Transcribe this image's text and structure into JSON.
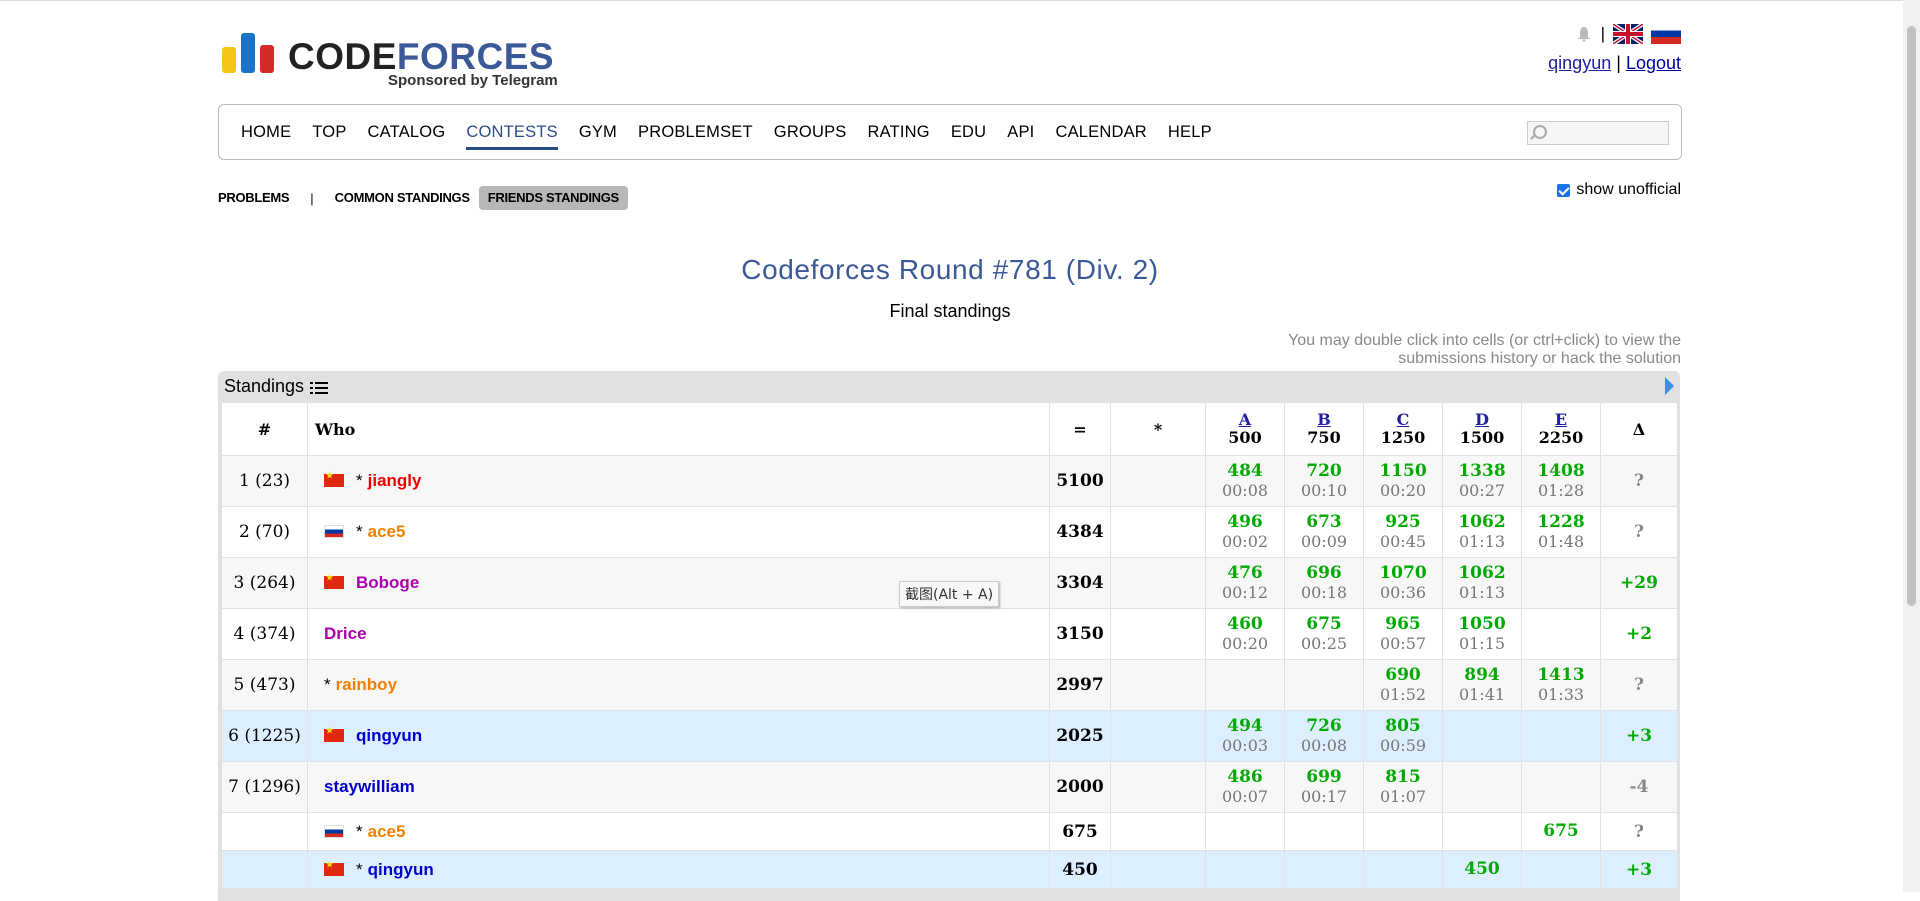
{
  "header": {
    "logo_word_main": "CODE",
    "logo_word_accent": "FORCES",
    "logo_sponsor": "Sponsored by Telegram",
    "user": "qingyun",
    "separator": "|",
    "logout": "Logout"
  },
  "menu": {
    "items": [
      "HOME",
      "TOP",
      "CATALOG",
      "CONTESTS",
      "GYM",
      "PROBLEMSET",
      "GROUPS",
      "RATING",
      "EDU",
      "API",
      "CALENDAR",
      "HELP"
    ],
    "active": "CONTESTS",
    "search_placeholder": ""
  },
  "subnav": {
    "problems": "PROBLEMS",
    "sep": "|",
    "common": "COMMON STANDINGS",
    "friends": "FRIENDS STANDINGS",
    "show_unofficial": "show unofficial"
  },
  "contest": {
    "title": "Codeforces Round #781 (Div. 2)",
    "status": "Final standings",
    "hint": "You may double click into cells (or ctrl+click) to view the submissions history or hack the solution"
  },
  "standings": {
    "panel_title": "Standings",
    "columns": {
      "rank": "#",
      "who": "Who",
      "points": "=",
      "penalty": "*",
      "delta": "Δ"
    },
    "problems": [
      {
        "letter": "A",
        "score": "500"
      },
      {
        "letter": "B",
        "score": "750"
      },
      {
        "letter": "C",
        "score": "1250"
      },
      {
        "letter": "D",
        "score": "1500"
      },
      {
        "letter": "E",
        "score": "2250"
      }
    ],
    "rows": [
      {
        "rank": "1 (23)",
        "star": "*",
        "flag": "cn",
        "name": "jiangly",
        "color": "red",
        "points": "5100",
        "penalty": "",
        "cells": [
          [
            "484",
            "00:08"
          ],
          [
            "720",
            "00:10"
          ],
          [
            "1150",
            "00:20"
          ],
          [
            "1338",
            "00:27"
          ],
          [
            "1408",
            "01:28"
          ]
        ],
        "delta": "?",
        "style": "alt"
      },
      {
        "rank": "2 (70)",
        "star": "*",
        "flag": "ru",
        "name": "ace5",
        "color": "orange",
        "points": "4384",
        "penalty": "",
        "cells": [
          [
            "496",
            "00:02"
          ],
          [
            "673",
            "00:09"
          ],
          [
            "925",
            "00:45"
          ],
          [
            "1062",
            "01:13"
          ],
          [
            "1228",
            "01:48"
          ]
        ],
        "delta": "?",
        "style": ""
      },
      {
        "rank": "3 (264)",
        "star": "",
        "flag": "cn",
        "name": "Boboge",
        "color": "purple",
        "points": "3304",
        "penalty": "",
        "cells": [
          [
            "476",
            "00:12"
          ],
          [
            "696",
            "00:18"
          ],
          [
            "1070",
            "00:36"
          ],
          [
            "1062",
            "01:13"
          ],
          [
            "",
            ""
          ]
        ],
        "delta": "+29",
        "style": "alt"
      },
      {
        "rank": "4 (374)",
        "star": "",
        "flag": "",
        "name": "Drice",
        "color": "purple",
        "points": "3150",
        "penalty": "",
        "cells": [
          [
            "460",
            "00:20"
          ],
          [
            "675",
            "00:25"
          ],
          [
            "965",
            "00:57"
          ],
          [
            "1050",
            "01:15"
          ],
          [
            "",
            ""
          ]
        ],
        "delta": "+2",
        "style": ""
      },
      {
        "rank": "5 (473)",
        "star": "*",
        "flag": "",
        "name": "rainboy",
        "color": "orange",
        "points": "2997",
        "penalty": "",
        "cells": [
          [
            "",
            ""
          ],
          [
            "",
            ""
          ],
          [
            "690",
            "01:52"
          ],
          [
            "894",
            "01:41"
          ],
          [
            "1413",
            "01:33"
          ]
        ],
        "delta": "?",
        "style": "alt"
      },
      {
        "rank": "6 (1225)",
        "star": "",
        "flag": "cn",
        "name": "qingyun",
        "color": "blue",
        "points": "2025",
        "penalty": "",
        "cells": [
          [
            "494",
            "00:03"
          ],
          [
            "726",
            "00:08"
          ],
          [
            "805",
            "00:59"
          ],
          [
            "",
            ""
          ],
          [
            "",
            ""
          ]
        ],
        "delta": "+3",
        "style": "me"
      },
      {
        "rank": "7 (1296)",
        "star": "",
        "flag": "",
        "name": "staywilliam",
        "color": "blue",
        "points": "2000",
        "penalty": "",
        "cells": [
          [
            "486",
            "00:07"
          ],
          [
            "699",
            "00:17"
          ],
          [
            "815",
            "01:07"
          ],
          [
            "",
            ""
          ],
          [
            "",
            ""
          ]
        ],
        "delta": "-4",
        "style": "alt"
      },
      {
        "rank": "",
        "star": "*",
        "flag": "ru",
        "name": "ace5",
        "color": "orange",
        "points": "675",
        "penalty": "",
        "cells": [
          [
            "",
            ""
          ],
          [
            "",
            ""
          ],
          [
            "",
            ""
          ],
          [
            "",
            ""
          ],
          [
            "675",
            ""
          ]
        ],
        "delta": "?",
        "style": "short"
      },
      {
        "rank": "",
        "star": "*",
        "flag": "cn",
        "name": "qingyun",
        "color": "blue",
        "points": "450",
        "penalty": "",
        "cells": [
          [
            "",
            ""
          ],
          [
            "",
            ""
          ],
          [
            "",
            ""
          ],
          [
            "450",
            ""
          ],
          [
            "",
            ""
          ]
        ],
        "delta": "+3",
        "style": "me short"
      }
    ]
  },
  "tooltip": "截图(Alt + A)",
  "colors": {
    "accent": "#3b5998",
    "accepted": "#00aa00",
    "highlight_row": "#ddeeff"
  }
}
